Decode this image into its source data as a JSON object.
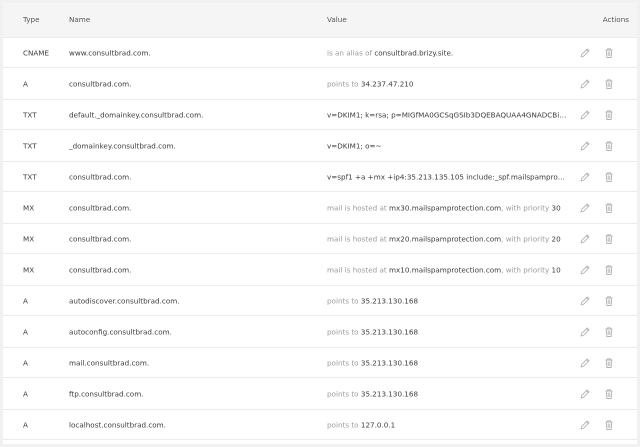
{
  "header": {
    "type": "Type",
    "name": "Name",
    "value": "Value",
    "actions": "Actions"
  },
  "records": [
    {
      "type": "CNAME",
      "name": "www.consultbrad.com.",
      "prefix": "is an alias of ",
      "main": "consultbrad.brizy.site.",
      "suffix": "",
      "extra": ""
    },
    {
      "type": "A",
      "name": "consultbrad.com.",
      "prefix": "points to ",
      "main": "34.237.47.210",
      "suffix": "",
      "extra": ""
    },
    {
      "type": "TXT",
      "name": "default._domainkey.consultbrad.com.",
      "prefix": "",
      "main": "v=DKIM1; k=rsa; p=MIGfMA0GCSqGSIb3DQEBAQUAA4GNADCBiQKB...",
      "suffix": "",
      "extra": ""
    },
    {
      "type": "TXT",
      "name": "_domainkey.consultbrad.com.",
      "prefix": "",
      "main": "v=DKIM1; o=~",
      "suffix": "",
      "extra": ""
    },
    {
      "type": "TXT",
      "name": "consultbrad.com.",
      "prefix": "",
      "main": "v=spf1 +a +mx +ip4:35.213.135.105 include:_spf.mailspamprotection...",
      "suffix": "",
      "extra": ""
    },
    {
      "type": "MX",
      "name": "consultbrad.com.",
      "prefix": "mail is hosted at ",
      "main": "mx30.mailspamprotection.com",
      "suffix": ", with priority ",
      "extra": "30"
    },
    {
      "type": "MX",
      "name": "consultbrad.com.",
      "prefix": "mail is hosted at ",
      "main": "mx20.mailspamprotection.com",
      "suffix": ", with priority ",
      "extra": "20"
    },
    {
      "type": "MX",
      "name": "consultbrad.com.",
      "prefix": "mail is hosted at ",
      "main": "mx10.mailspamprotection.com",
      "suffix": ", with priority ",
      "extra": "10"
    },
    {
      "type": "A",
      "name": "autodiscover.consultbrad.com.",
      "prefix": "points to ",
      "main": "35.213.130.168",
      "suffix": "",
      "extra": ""
    },
    {
      "type": "A",
      "name": "autoconfig.consultbrad.com.",
      "prefix": "points to ",
      "main": "35.213.130.168",
      "suffix": "",
      "extra": ""
    },
    {
      "type": "A",
      "name": "mail.consultbrad.com.",
      "prefix": "points to ",
      "main": "35.213.130.168",
      "suffix": "",
      "extra": ""
    },
    {
      "type": "A",
      "name": "ftp.consultbrad.com.",
      "prefix": "points to ",
      "main": "35.213.130.168",
      "suffix": "",
      "extra": ""
    },
    {
      "type": "A",
      "name": "localhost.consultbrad.com.",
      "prefix": "points to ",
      "main": "127.0.0.1",
      "suffix": "",
      "extra": ""
    }
  ],
  "icons": {
    "edit": "pencil-icon",
    "delete": "trash-icon",
    "color": "#b4b4b4"
  }
}
